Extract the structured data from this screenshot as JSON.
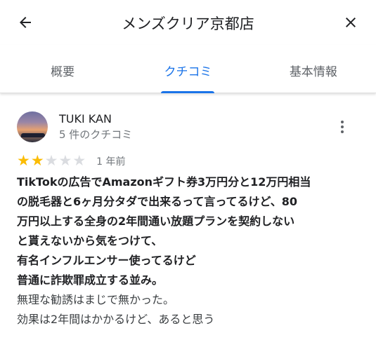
{
  "header": {
    "title": "メンズクリア京都店",
    "back_icon": "arrow-back-icon",
    "close_icon": "close-icon"
  },
  "tabs": [
    {
      "label": "概要",
      "active": false
    },
    {
      "label": "クチコミ",
      "active": true
    },
    {
      "label": "基本情報",
      "active": false
    }
  ],
  "review": {
    "reviewer_name": "TUKI KAN",
    "reviewer_meta": "5 件のクチコミ",
    "rating": 2,
    "rating_max": 5,
    "time": "1 年前",
    "bold_lines": [
      "TikTokの広告でAmazonギフト券3万円分と12万円相当",
      "の脱毛器と6ヶ月分タダで出来るって言ってるけど、80",
      "万円以上する全身の2年間通い放題プランを契約しない",
      "と貰えないから気をつけて、",
      "有名インフルエンサー使ってるけど",
      "普通に詐欺罪成立する並み。"
    ],
    "normal_lines": [
      "無理な勧誘はまじで無かった。",
      "効果は2年間はかかるけど、あると思う"
    ]
  },
  "colors": {
    "accent": "#1a73e8",
    "star_on": "#fbbc04",
    "star_off": "#dadce0"
  }
}
